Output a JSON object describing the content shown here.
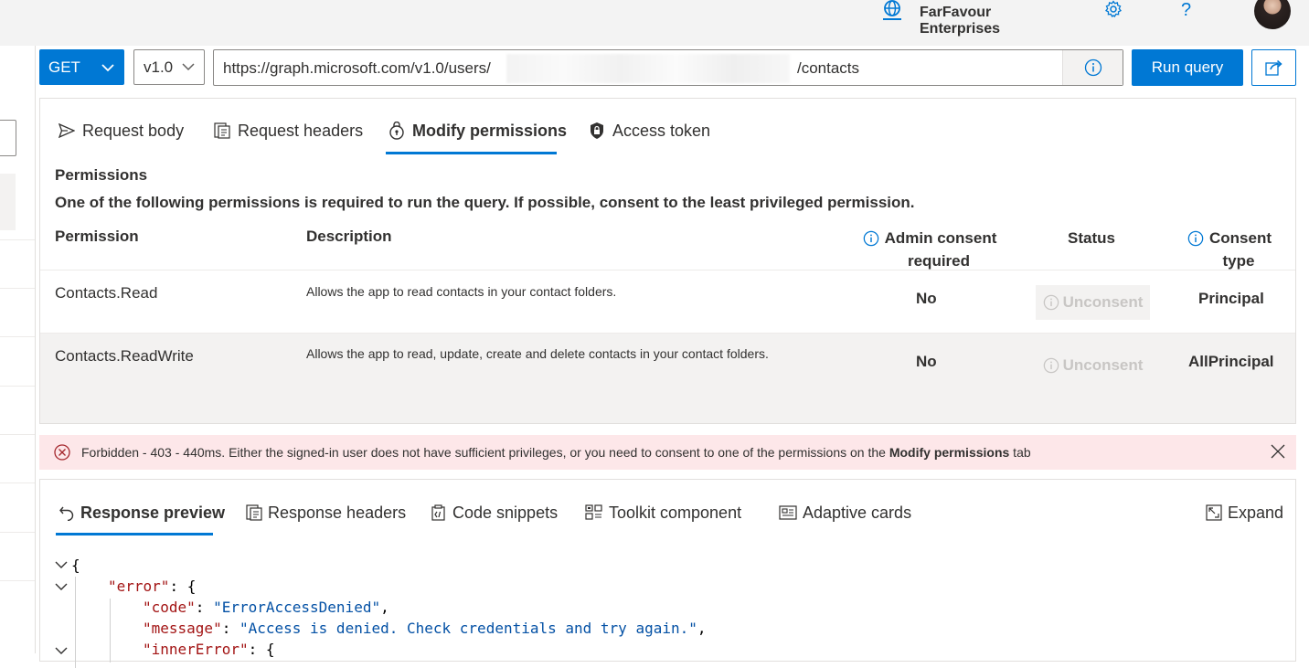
{
  "header": {
    "tenant_line1": "FarFavour",
    "tenant_line2": "Enterprises",
    "help_glyph": "?",
    "icons": [
      "globe-icon",
      "gear-icon",
      "help-icon",
      "avatar"
    ]
  },
  "query": {
    "method": "GET",
    "version": "v1.0",
    "url_prefix": "https://graph.microsoft.com/v1.0/users/",
    "url_suffix": "/contacts",
    "run_label": "Run query"
  },
  "request_tabs": [
    {
      "label": "Request body",
      "icon": "send-icon"
    },
    {
      "label": "Request headers",
      "icon": "headers-icon"
    },
    {
      "label": "Modify permissions",
      "icon": "permissions-icon",
      "active": true
    },
    {
      "label": "Access token",
      "icon": "lock-icon"
    }
  ],
  "permissions": {
    "title": "Permissions",
    "description": "One of the following permissions is required to run the query. If possible, consent to the least privileged permission.",
    "columns": {
      "permission": "Permission",
      "description": "Description",
      "admin_consent_line1": "Admin consent",
      "admin_consent_line2": "required",
      "status": "Status",
      "consent_type_line1": "Consent",
      "consent_type_line2": "type"
    },
    "rows": [
      {
        "permission": "Contacts.Read",
        "description": "Allows the app to read contacts in your contact folders.",
        "admin_consent": "No",
        "status": "Unconsent",
        "consent_type": "Principal"
      },
      {
        "permission": "Contacts.ReadWrite",
        "description": "Allows the app to read, update, create and delete contacts in your contact folders.",
        "admin_consent": "No",
        "status": "Unconsent",
        "consent_type": "AllPrincipal"
      }
    ]
  },
  "error": {
    "text": "Forbidden - 403 - 440ms. Either the signed-in user does not have sufficient privileges, or you need to consent to one of the permissions on the ",
    "bold": "Modify permissions",
    "tail": " tab"
  },
  "response_tabs": [
    {
      "label": "Response preview",
      "icon": "undo-icon",
      "active": true
    },
    {
      "label": "Response headers",
      "icon": "headers-icon"
    },
    {
      "label": "Code snippets",
      "icon": "code-icon"
    },
    {
      "label": "Toolkit component",
      "icon": "toolkit-icon"
    },
    {
      "label": "Adaptive cards",
      "icon": "card-icon"
    },
    {
      "label": "Expand",
      "icon": "expand-icon"
    }
  ],
  "response_json": {
    "open_brace": "{",
    "error_key": "\"error\"",
    "error_open": ": {",
    "code_key": "\"code\"",
    "code_value": "\"ErrorAccessDenied\"",
    "message_key": "\"message\"",
    "message_value": "\"Access is denied. Check credentials and try again.\"",
    "inner_key": "\"innerError\"",
    "inner_open": ": {",
    "colon": ": ",
    "comma": ","
  },
  "colors": {
    "accent": "#0078d4",
    "error_bg": "#fde7e9",
    "error_red": "#a4262c",
    "json_key": "#a31515",
    "json_string": "#0451a5"
  }
}
